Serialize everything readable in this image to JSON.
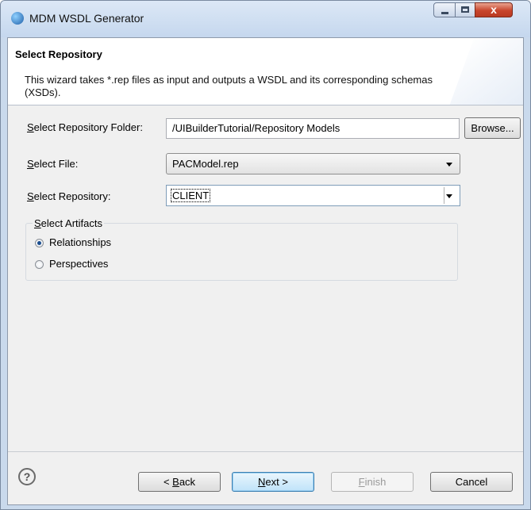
{
  "window": {
    "title": "MDM WSDL Generator",
    "controls": {
      "minimize": "—",
      "maximize": "☐",
      "close": "x"
    }
  },
  "banner": {
    "title": "Select Repository",
    "description": "This wizard takes *.rep files as input and outputs a WSDL and its corresponding schemas (XSDs)."
  },
  "form": {
    "folder_label": "Select Repository Folder:",
    "folder_value": "/UIBuilderTutorial/Repository Models",
    "browse_label": "Browse...",
    "file_label": "Select File:",
    "file_value": "PACModel.rep",
    "repository_label": "Select Repository:",
    "repository_value": "CLIENT"
  },
  "artifacts": {
    "title": "Select Artifacts",
    "options": [
      {
        "label": "Relationships",
        "selected": true
      },
      {
        "label": "Perspectives",
        "selected": false
      }
    ]
  },
  "footer": {
    "help_symbol": "?",
    "back_label": "< Back",
    "next_label": "Next >",
    "finish_label": "Finish",
    "cancel_label": "Cancel"
  }
}
